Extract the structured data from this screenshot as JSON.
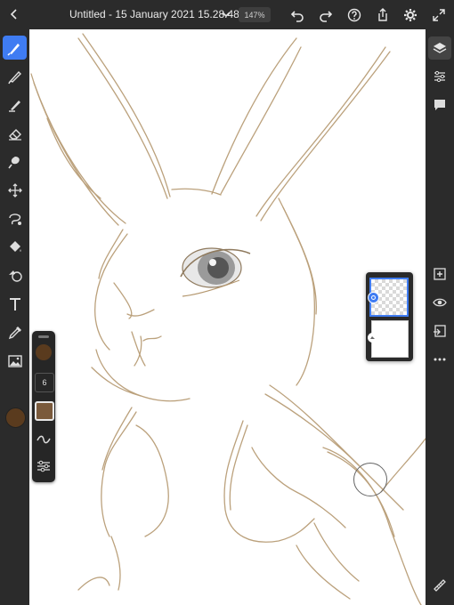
{
  "header": {
    "document_title": "Untitled - 15 January 2021 15.28.48 *",
    "zoom_level": "147%",
    "icons": [
      "back-chevron-icon",
      "title-chevron-down-icon",
      "undo-icon",
      "redo-icon",
      "help-icon",
      "share-icon",
      "settings-icon",
      "fullscreen-icon"
    ]
  },
  "left_toolbar": {
    "tools": [
      "brush-tool",
      "smudge-brush-tool",
      "eraser-brush-tool",
      "eraser-tool",
      "liquify-tool",
      "transform-tool",
      "lasso-select-tool",
      "fill-tool",
      "shape-tool",
      "text-tool",
      "eyedropper-tool",
      "image-tool"
    ],
    "active_tool": "brush-tool",
    "current_color": "#5a3b1e"
  },
  "brush_panel": {
    "size_value": "6",
    "color_hex": "#7a5a3c"
  },
  "right_toolbar": {
    "tools": [
      "layers-icon",
      "layer-properties-icon",
      "comments-icon",
      "add-layer-icon",
      "visibility-icon",
      "merge-down-icon",
      "more-options-icon",
      "ruler-icon"
    ]
  },
  "layers": {
    "items": [
      {
        "name": "active-layer-transparent",
        "selected": true
      },
      {
        "name": "background-layer",
        "selected": false
      }
    ]
  }
}
